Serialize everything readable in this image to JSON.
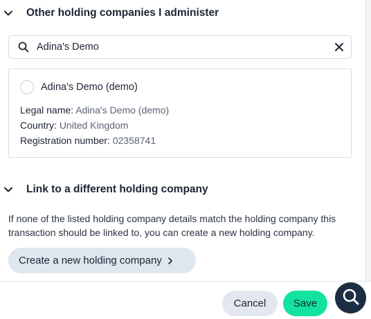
{
  "sections": {
    "other_companies": {
      "title": "Other holding companies I administer"
    },
    "link_different": {
      "title": "Link to a different holding company"
    }
  },
  "search": {
    "value": "Adina's Demo",
    "placeholder": "Search"
  },
  "result": {
    "name": "Adina's Demo (demo)",
    "legal_name_label": "Legal name:",
    "legal_name_value": "Adina's Demo (demo)",
    "country_label": "Country:",
    "country_value": "United Kingdom",
    "registration_label": "Registration number:",
    "registration_value": "02358741"
  },
  "info": {
    "line1": "If none of the listed holding company details match the holding company this",
    "line2": "transaction should be linked to, you can create a new holding company."
  },
  "buttons": {
    "create": "Create a new holding company",
    "cancel": "Cancel",
    "save": "Save"
  },
  "colors": {
    "save_accent": "#14e3a0",
    "text_primary": "#1c2434",
    "button_secondary": "#dfe6ee",
    "help_fab": "#1c2e43"
  },
  "icons": {
    "search": "search-icon",
    "clear": "close-icon",
    "collapse": "chevron-down-icon",
    "next": "chevron-right-icon",
    "help": "search-help-icon"
  }
}
